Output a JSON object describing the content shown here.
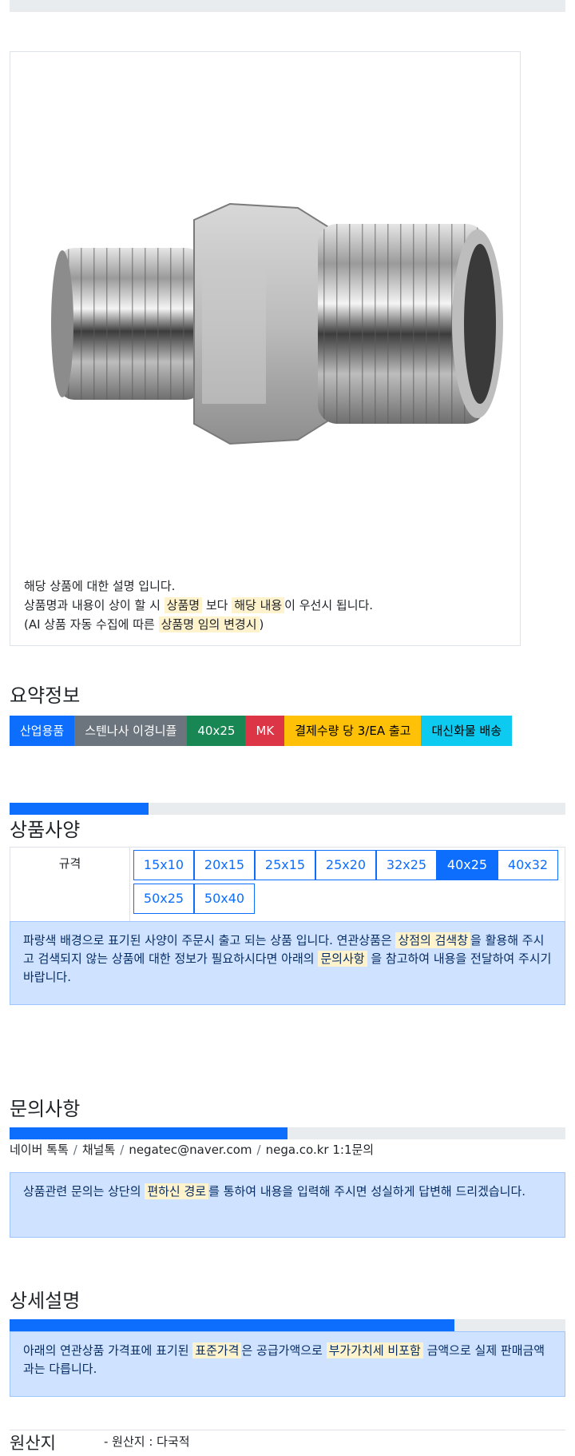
{
  "product_card": {
    "desc_line1": "해당 상품에 대한 설명 입니다.",
    "desc_line2_a": "상품명과 내용이 상이 할 시 ",
    "desc_line2_hl1": "상품명",
    "desc_line2_b": " 보다 ",
    "desc_line2_hl2": "해당 내용",
    "desc_line2_c": "이 우선시 됩니다.",
    "desc_line3_a": "(AI 상품 자동 수집에 따른 ",
    "desc_line3_hl": "상품명 임의 변경시",
    "desc_line3_b": ")"
  },
  "summary": {
    "title": "요약정보",
    "badges": [
      {
        "label": "산업용품",
        "color": "#0d6efd",
        "text_color": "#ffffff"
      },
      {
        "label": "스텐나사 이경니플",
        "color": "#6c757d",
        "text_color": "#ffffff"
      },
      {
        "label": "40x25",
        "color": "#198754",
        "text_color": "#ffffff"
      },
      {
        "label": "MK",
        "color": "#dc3545",
        "text_color": "#ffffff"
      },
      {
        "label": "결제수량 당 3/EA 출고",
        "color": "#ffc107",
        "text_color": "#000000"
      },
      {
        "label": "대신화물 배송",
        "color": "#0dcaf0",
        "text_color": "#000000"
      }
    ]
  },
  "spec": {
    "title": "상품사양",
    "progress": 0.25,
    "label": "규격",
    "options": [
      "15x10",
      "20x15",
      "25x15",
      "25x20",
      "32x25",
      "40x25",
      "40x32",
      "50x25",
      "50x40"
    ],
    "selected": "40x25",
    "notice_a": "파랑색 배경으로 표기된 사양이 주문시 출고 되는 상품 입니다. 연관상품은 ",
    "notice_hl1": "상점의 검색창",
    "notice_b": "을 활용해 주시고 검색되지 않는 상품에 대한 정보가 필요하시다면 아래의 ",
    "notice_hl2": "문의사항",
    "notice_c": " 을 참고하여 내용을 전달하여 주시기 바랍니다."
  },
  "inquiry": {
    "title": "문의사항",
    "progress": 0.5,
    "contacts": [
      "네이버 톡톡",
      "채널톡",
      "negatec@naver.com",
      "nega.co.kr 1:1문의"
    ],
    "separator": "/",
    "notice_a": "상품관련 문의는 상단의 ",
    "notice_hl": "편하신 경로",
    "notice_b": "를 통하여 내용을 입력해 주시면 성실하게 답변해 드리겠습니다."
  },
  "detail": {
    "title": "상세설명",
    "progress": 0.8,
    "notice_a": "아래의 연관상품 가격표에 표기된 ",
    "notice_hl1": "표준가격",
    "notice_b": "은 공급가액으로 ",
    "notice_hl2": "부가가치세 비포함",
    "notice_c": " 금액으로 실제 판매금액과는 다릅니다."
  },
  "origin": {
    "label": "원산지",
    "value": "- 원산지 : 다국적"
  },
  "colors": {
    "primary": "#0d6efd",
    "alert_bg": "#cfe2ff",
    "highlight": "#fff3cd"
  }
}
